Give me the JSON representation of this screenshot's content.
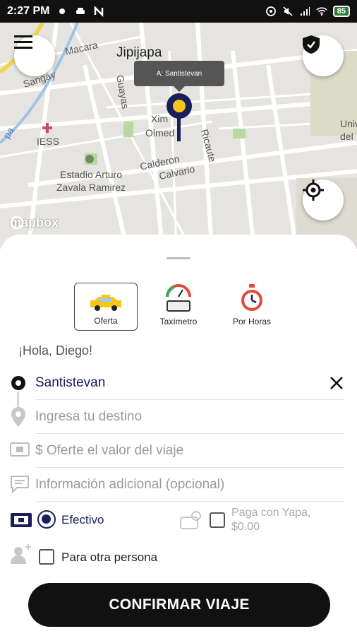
{
  "status_bar": {
    "time": "2:27 PM",
    "battery": "85"
  },
  "map": {
    "city": "Jipijapa",
    "tooltip": "A: Santistevan",
    "attribution": "mapbox",
    "labels": {
      "macara": "Macara",
      "sangay": "Sangay",
      "guayas": "Guayas",
      "ximena": "Xim",
      "olmedo": "Olmed",
      "ricaute": "Ricaute",
      "calderon": "Calderon",
      "calvario": "Calvario",
      "iess": "IESS",
      "estadio": "Estadio Arturo\nZavala Ramirez",
      "univ": "Univ\ndel",
      "pa": "pa"
    }
  },
  "service_modes": [
    {
      "label": "Oferta",
      "icon": "taxi-icon"
    },
    {
      "label": "Taxímetro",
      "icon": "taximeter-icon"
    },
    {
      "label": "Por Horas",
      "icon": "stopwatch-icon"
    }
  ],
  "greeting": "¡Hola, Diego!",
  "origin": {
    "value": "Santistevan"
  },
  "destination": {
    "placeholder": "Ingresa tu destino"
  },
  "offer": {
    "placeholder": "$ Oferte el valor del viaje"
  },
  "info": {
    "placeholder": "Información adicional (opcional)"
  },
  "payment": {
    "cash_label": "Efectivo",
    "yapa_label": "Paga con Yapa,",
    "yapa_amount": "$0.00"
  },
  "other_person_label": "Para otra persona",
  "confirm_label": "CONFIRMAR VIAJE",
  "colors": {
    "accent": "#1a1e5a",
    "pin_yellow": "#f5c518",
    "button": "#111111"
  }
}
